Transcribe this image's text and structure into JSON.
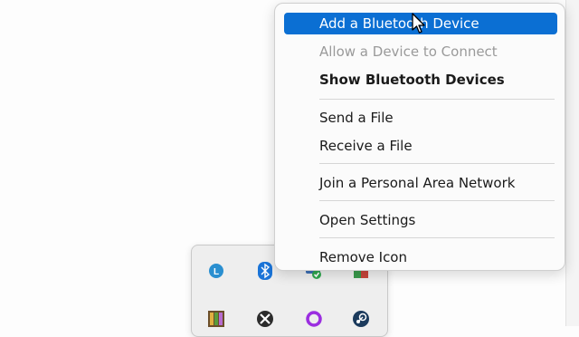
{
  "menu": {
    "items": [
      {
        "label": "Add a Bluetooth Device",
        "state": "highlighted"
      },
      {
        "label": "Allow a Device to Connect",
        "state": "disabled"
      },
      {
        "label": "Show Bluetooth Devices",
        "state": "bold"
      },
      {
        "label": "Send a File",
        "state": "normal"
      },
      {
        "label": "Receive a File",
        "state": "normal"
      },
      {
        "label": "Join a Personal Area Network",
        "state": "normal"
      },
      {
        "label": "Open Settings",
        "state": "normal"
      },
      {
        "label": "Remove Icon",
        "state": "normal"
      }
    ],
    "highlight_color": "#0b6fd3"
  },
  "tray": {
    "icons": [
      "clock-app-icon",
      "bluetooth-icon",
      "security-check-icon",
      "app-icon",
      "colorful-app-icon",
      "xbox-icon",
      "purple-ring-icon",
      "steam-icon"
    ]
  }
}
